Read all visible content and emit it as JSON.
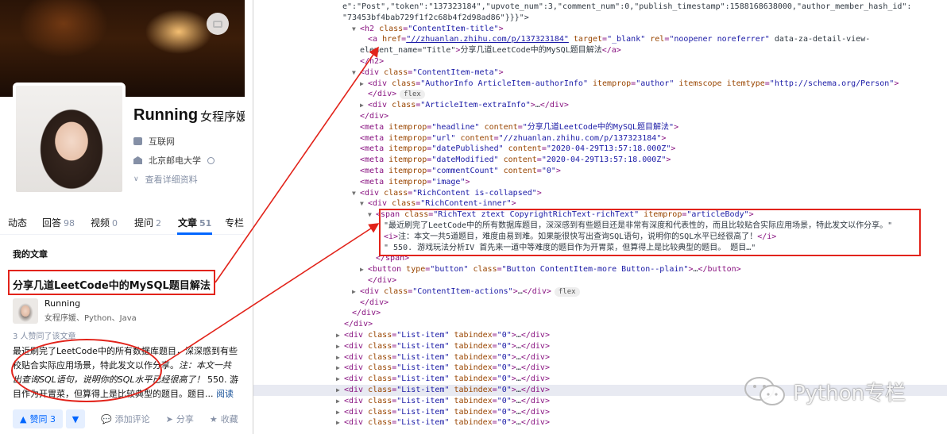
{
  "profile": {
    "name": "Running",
    "headline": "女程序媛",
    "industry": "互联网",
    "school": "北京邮电大学",
    "view_detail": "查看详细资料"
  },
  "tabs": [
    {
      "label": "动态",
      "count": ""
    },
    {
      "label": "回答",
      "count": "98"
    },
    {
      "label": "视频",
      "count": "0"
    },
    {
      "label": "提问",
      "count": "2"
    },
    {
      "label": "文章",
      "count": "51"
    },
    {
      "label": "专栏",
      "count": ""
    }
  ],
  "active_tab": "文章",
  "section_title": "我的文章",
  "article": {
    "title": "分享几道LeetCode中的MySQL题目解法",
    "author_name": "Running",
    "author_headline": "女程序媛、Python、Java",
    "upvoted_text": "3 人赞同了该文章",
    "excerpt_lines": [
      "最近刷完了LeetCode中的所有数据库题目，深深感到有些",
      "校贴合实际应用场景，特此发文以作分享。",
      "出查询SQL语句，说明你的SQL水平已经很高了！",
      "目作为开胃菜，但算得上是比较典型的题目。题目..."
    ],
    "excerpt_italic_1": "注：本文一共",
    "excerpt_tail_3": " 550. 游",
    "read_more": "阅读",
    "upvote_label": "赞同 3",
    "comment_label": "添加评论",
    "share_label": "分享",
    "collect_label": "收藏"
  },
  "devtools": {
    "lines": [
      {
        "indent": 0,
        "tri": "",
        "html": "e\":\"Post\",\"token\":\"137323184\",\"upvote_num\":3,\"comment_num\":0,\"publish_timestamp\":1588168638000,\"author_member_hash_id\":"
      },
      {
        "indent": 0,
        "tri": "",
        "html": "\"73453bf4bab729f1f2c68b4f2d98ad86\"}}}\">"
      },
      {
        "indent": 2,
        "tri": "▼",
        "html": "<h2 class=\"ContentItem-title\">"
      },
      {
        "indent": 3,
        "tri": "",
        "html": "<a href=\"//zhuanlan.zhihu.com/p/137323184\" target=\"_blank\" rel=\"noopener noreferrer\" data-za-detail-view-"
      },
      {
        "indent": 2,
        "tri": "",
        "html": "element_name=\"Title\">分享几道LeetCode中的MySQL题目解法</a>"
      },
      {
        "indent": 2,
        "tri": "",
        "html": "</h2>"
      },
      {
        "indent": 2,
        "tri": "▼",
        "html": "<div class=\"ContentItem-meta\">"
      },
      {
        "indent": 3,
        "tri": "▶",
        "html": "<div class=\"AuthorInfo ArticleItem-authorInfo\" itemprop=\"author\" itemscope itemtype=\"http://schema.org/Person\">"
      },
      {
        "indent": 3,
        "tri": "",
        "html": "</div>"
      },
      {
        "indent": 3,
        "tri": "▶",
        "html": "<div class=\"ArticleItem-extraInfo\">…</div>"
      },
      {
        "indent": 2,
        "tri": "",
        "html": "</div>"
      },
      {
        "indent": 2,
        "tri": "",
        "html": "<meta itemprop=\"headline\" content=\"分享几道LeetCode中的MySQL题目解法\">"
      },
      {
        "indent": 2,
        "tri": "",
        "html": "<meta itemprop=\"url\" content=\"//zhuanlan.zhihu.com/p/137323184\">"
      },
      {
        "indent": 2,
        "tri": "",
        "html": "<meta itemprop=\"datePublished\" content=\"2020-04-29T13:57:18.000Z\">"
      },
      {
        "indent": 2,
        "tri": "",
        "html": "<meta itemprop=\"dateModified\" content=\"2020-04-29T13:57:18.000Z\">"
      },
      {
        "indent": 2,
        "tri": "",
        "html": "<meta itemprop=\"commentCount\" content=\"0\">"
      },
      {
        "indent": 2,
        "tri": "",
        "html": "<meta itemprop=\"image\">"
      },
      {
        "indent": 2,
        "tri": "▼",
        "html": "<div class=\"RichContent is-collapsed\">"
      },
      {
        "indent": 3,
        "tri": "▼",
        "html": "<div class=\"RichContent-inner\">"
      },
      {
        "indent": 4,
        "tri": "▼",
        "html": "<span class=\"RichText ztext CopyrightRichText-richText\" itemprop=\"articleBody\">"
      },
      {
        "indent": 5,
        "tri": "",
        "html": "\"最近刷完了LeetCode中的所有数据库题目，深深感到有些题目还是非常有深度和代表性的，而且比较贴合实际应用场景，特此发文以作分享。\""
      },
      {
        "indent": 5,
        "tri": "",
        "html": "<i>注：本文一共5道题目，难度由易到难。如果能很快写出查询SQL语句，说明你的SQL水平已经很高了！</i>"
      },
      {
        "indent": 5,
        "tri": "",
        "html": "\" 550. 游戏玩法分析IV 首先来一道中等难度的题目作为开胃菜，但算得上是比较典型的题目。 题目…\""
      },
      {
        "indent": 4,
        "tri": "",
        "html": "</span>"
      },
      {
        "indent": 3,
        "tri": "▶",
        "html": "<button type=\"button\" class=\"Button ContentItem-more Button--plain\">…</button>"
      },
      {
        "indent": 3,
        "tri": "",
        "html": "</div>"
      },
      {
        "indent": 2,
        "tri": "▶",
        "html": "<div class=\"ContentItem-actions\">…</div>"
      },
      {
        "indent": 2,
        "tri": "",
        "html": "</div>"
      },
      {
        "indent": 1,
        "tri": "",
        "html": "</div>"
      },
      {
        "indent": 0,
        "tri": "",
        "html": "</div>"
      },
      {
        "indent": 0,
        "tri": "▶",
        "html": "<div class=\"List-item\" tabindex=\"0\">…</div>"
      },
      {
        "indent": 0,
        "tri": "▶",
        "html": "<div class=\"List-item\" tabindex=\"0\">…</div>"
      },
      {
        "indent": 0,
        "tri": "▶",
        "html": "<div class=\"List-item\" tabindex=\"0\">…</div>"
      },
      {
        "indent": 0,
        "tri": "▶",
        "html": "<div class=\"List-item\" tabindex=\"0\">…</div>"
      },
      {
        "indent": 0,
        "tri": "▶",
        "html": "<div class=\"List-item\" tabindex=\"0\">…</div>"
      },
      {
        "indent": 0,
        "tri": "▶",
        "html": "<div class=\"List-item\" tabindex=\"0\">…</div>"
      },
      {
        "indent": 0,
        "tri": "▶",
        "html": "<div class=\"List-item\" tabindex=\"0\">…</div>"
      },
      {
        "indent": 0,
        "tri": "▶",
        "html": "<div class=\"List-item\" tabindex=\"0\">…</div>"
      },
      {
        "indent": 0,
        "tri": "▶",
        "html": "<div class=\"List-item\" tabindex=\"0\">…</div>"
      }
    ],
    "flex_pill": "flex"
  },
  "watermark": "Python专栏",
  "colors": {
    "accent": "#0066ff",
    "annotation_red": "#e2231a"
  }
}
